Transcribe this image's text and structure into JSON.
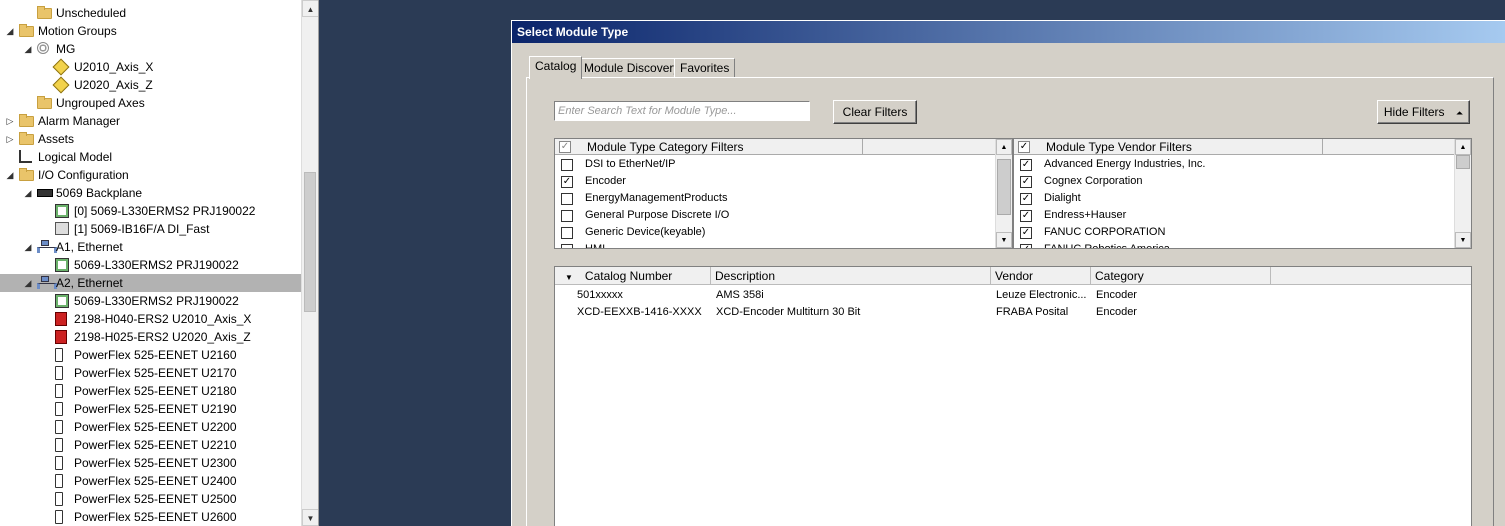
{
  "tree": [
    {
      "label": "Unscheduled",
      "icon": "folder-icon",
      "depth": 2,
      "expander": "",
      "selected": false
    },
    {
      "label": "Motion Groups",
      "icon": "folder-icon",
      "depth": 1,
      "expander": "collapse",
      "selected": false
    },
    {
      "label": "MG",
      "icon": "motion-group-icon",
      "depth": 2,
      "expander": "collapse",
      "selected": false
    },
    {
      "label": "U2010_Axis_X",
      "icon": "axis-icon",
      "depth": 3,
      "expander": "",
      "selected": false
    },
    {
      "label": "U2020_Axis_Z",
      "icon": "axis-icon",
      "depth": 3,
      "expander": "",
      "selected": false
    },
    {
      "label": "Ungrouped Axes",
      "icon": "folder-icon",
      "depth": 2,
      "expander": "",
      "selected": false
    },
    {
      "label": "Alarm Manager",
      "icon": "folder-icon",
      "depth": 1,
      "expander": "expand",
      "selected": false
    },
    {
      "label": "Assets",
      "icon": "folder-icon",
      "depth": 1,
      "expander": "expand",
      "selected": false
    },
    {
      "label": "Logical Model",
      "icon": "logical-model-icon",
      "depth": 1,
      "expander": "",
      "selected": false
    },
    {
      "label": "I/O Configuration",
      "icon": "folder-icon",
      "depth": 1,
      "expander": "collapse",
      "selected": false
    },
    {
      "label": "5069 Backplane",
      "icon": "backplane-icon",
      "depth": 2,
      "expander": "collapse",
      "selected": false
    },
    {
      "label": "[0] 5069-L330ERMS2 PRJ190022",
      "icon": "controller-icon",
      "depth": 3,
      "expander": "",
      "selected": false
    },
    {
      "label": "[1] 5069-IB16F/A DI_Fast",
      "icon": "io-module-icon",
      "depth": 3,
      "expander": "",
      "selected": false
    },
    {
      "label": "A1, Ethernet",
      "icon": "ethernet-icon",
      "depth": 2,
      "expander": "collapse",
      "selected": false
    },
    {
      "label": "5069-L330ERMS2 PRJ190022",
      "icon": "controller-icon",
      "depth": 3,
      "expander": "",
      "selected": false
    },
    {
      "label": "A2, Ethernet",
      "icon": "ethernet-icon",
      "depth": 2,
      "expander": "collapse",
      "selected": true
    },
    {
      "label": "5069-L330ERMS2 PRJ190022",
      "icon": "controller-icon",
      "depth": 3,
      "expander": "",
      "selected": false
    },
    {
      "label": "2198-H040-ERS2 U2010_Axis_X",
      "icon": "drive-icon",
      "depth": 3,
      "expander": "",
      "selected": false
    },
    {
      "label": "2198-H025-ERS2 U2020_Axis_Z",
      "icon": "drive-icon",
      "depth": 3,
      "expander": "",
      "selected": false
    },
    {
      "label": "PowerFlex 525-EENET U2160",
      "icon": "powerflex-icon",
      "depth": 3,
      "expander": "",
      "selected": false
    },
    {
      "label": "PowerFlex 525-EENET U2170",
      "icon": "powerflex-icon",
      "depth": 3,
      "expander": "",
      "selected": false
    },
    {
      "label": "PowerFlex 525-EENET U2180",
      "icon": "powerflex-icon",
      "depth": 3,
      "expander": "",
      "selected": false
    },
    {
      "label": "PowerFlex 525-EENET U2190",
      "icon": "powerflex-icon",
      "depth": 3,
      "expander": "",
      "selected": false
    },
    {
      "label": "PowerFlex 525-EENET U2200",
      "icon": "powerflex-icon",
      "depth": 3,
      "expander": "",
      "selected": false
    },
    {
      "label": "PowerFlex 525-EENET U2210",
      "icon": "powerflex-icon",
      "depth": 3,
      "expander": "",
      "selected": false
    },
    {
      "label": "PowerFlex 525-EENET U2300",
      "icon": "powerflex-icon",
      "depth": 3,
      "expander": "",
      "selected": false
    },
    {
      "label": "PowerFlex 525-EENET U2400",
      "icon": "powerflex-icon",
      "depth": 3,
      "expander": "",
      "selected": false
    },
    {
      "label": "PowerFlex 525-EENET U2500",
      "icon": "powerflex-icon",
      "depth": 3,
      "expander": "",
      "selected": false
    },
    {
      "label": "PowerFlex 525-EENET U2600",
      "icon": "powerflex-icon",
      "depth": 3,
      "expander": "",
      "selected": false
    }
  ],
  "dialog": {
    "title": "Select Module Type",
    "tabs": [
      {
        "label": "Catalog",
        "active": true
      },
      {
        "label": "Module Discovery",
        "active": false
      },
      {
        "label": "Favorites",
        "active": false
      }
    ],
    "search": {
      "value": "",
      "placeholder": "Enter Search Text for Module Type..."
    },
    "clear_filters_label": "Clear Filters",
    "hide_filters_label": "Hide Filters",
    "hide_filters_icon": "double-chevron-up-icon",
    "category_filters": {
      "header": "Module Type Category Filters",
      "items": [
        {
          "label": "DSI to EtherNet/IP",
          "checked": false
        },
        {
          "label": "Encoder",
          "checked": true
        },
        {
          "label": "EnergyManagementProducts",
          "checked": false
        },
        {
          "label": "General Purpose Discrete I/O",
          "checked": false
        },
        {
          "label": "Generic Device(keyable)",
          "checked": false
        },
        {
          "label": "HMI",
          "checked": false
        }
      ]
    },
    "vendor_filters": {
      "header": "Module Type Vendor Filters",
      "items": [
        {
          "label": "Advanced Energy Industries, Inc.",
          "checked": true
        },
        {
          "label": "Cognex Corporation",
          "checked": true
        },
        {
          "label": "Dialight",
          "checked": true
        },
        {
          "label": "Endress+Hauser",
          "checked": true
        },
        {
          "label": "FANUC CORPORATION",
          "checked": true
        },
        {
          "label": "FANUC Robotics America",
          "checked": true
        }
      ]
    },
    "results": {
      "columns": [
        "Catalog Number",
        "Description",
        "Vendor",
        "Category"
      ],
      "rows": [
        [
          "501xxxxx",
          "AMS 358i",
          "Leuze Electronic...",
          "Encoder"
        ],
        [
          "XCD-EEXXB-1416-XXXX",
          "XCD-Encoder Multiturn 30 Bit",
          "FRABA Posital",
          "Encoder"
        ]
      ]
    }
  }
}
